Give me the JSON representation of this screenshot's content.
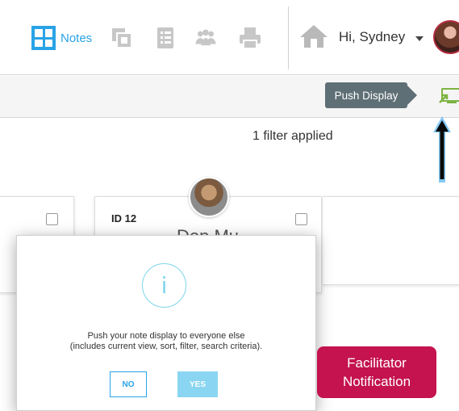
{
  "nav": {
    "notes_label": "Notes",
    "greeting": "Hi, Sydney",
    "icons": [
      "grid-icon",
      "copy-icon",
      "list-icon",
      "people-icon",
      "print-icon",
      "home-icon",
      "caret-down-icon"
    ]
  },
  "toolbar": {
    "push_display_tooltip": "Push Display",
    "push_icon": "push-display-icon"
  },
  "content": {
    "filter_status": "1 filter applied",
    "card": {
      "id_label": "ID 12",
      "name": "Don Mu"
    }
  },
  "modal": {
    "icon": "info-icon",
    "info_glyph": "i",
    "message_line1": "Push your note display to everyone else",
    "message_line2": "(includes current view, sort, filter, search criteria).",
    "no_label": "NO",
    "yes_label": "YES"
  },
  "callout": {
    "line1": "Facilitator",
    "line2": "Notification"
  },
  "colors": {
    "accent_blue": "#29a3e6",
    "tooltip_bg": "#5f6f76",
    "push_icon_green": "#7cb342",
    "callout_bg": "#c4134f",
    "arrow_glow": "#1e9be8"
  }
}
